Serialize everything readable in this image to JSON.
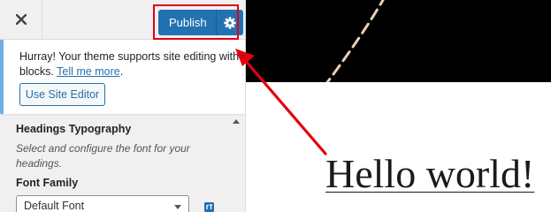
{
  "header": {
    "close_label": "Close customizer",
    "publish_label": "Publish"
  },
  "notice": {
    "text": "Hurray! Your theme supports site editing with blocks.",
    "link": "Tell me more",
    "trailing": ".",
    "button": "Use Site Editor"
  },
  "section": {
    "title": "Headings Typography",
    "description": "Select and configure the font for your headings.",
    "field_label": "Font Family",
    "select_value": "Default Font"
  },
  "preview": {
    "title": "Hello world!"
  },
  "colors": {
    "accent": "#2271b1",
    "annotation": "#e3000f",
    "notice_border": "#72aee6",
    "hero_background": "#000000"
  },
  "icons": {
    "close": "close-icon",
    "publish_settings": "gear-icon",
    "reset": "reset-icon",
    "scroll": "chevron-up-icon"
  }
}
